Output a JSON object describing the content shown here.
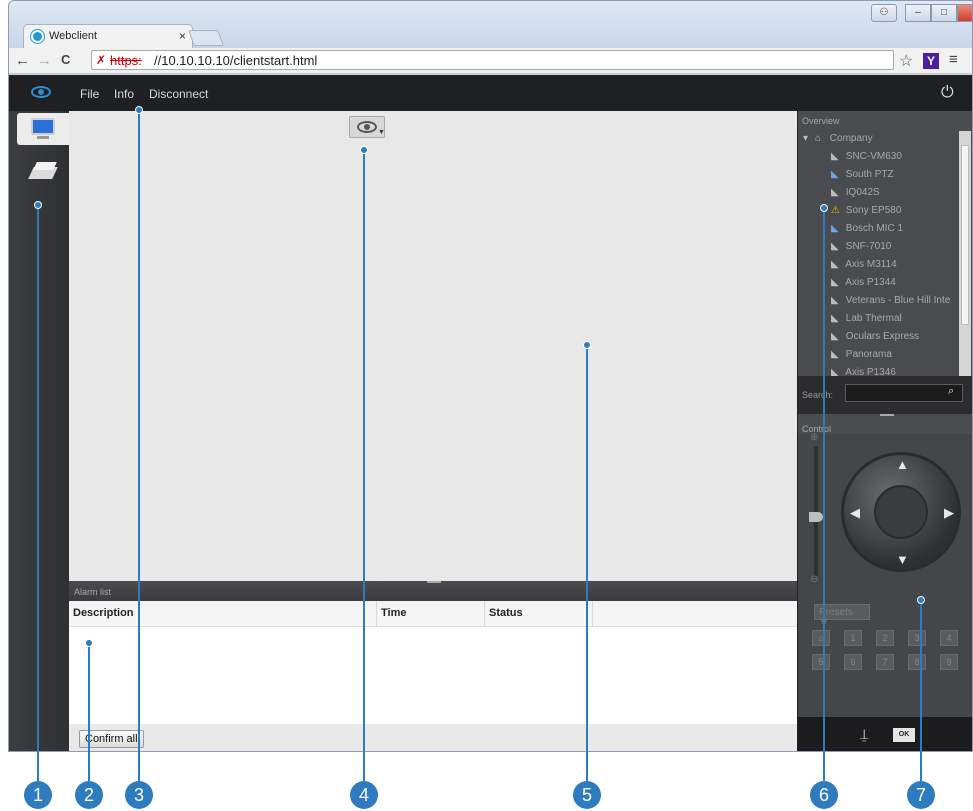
{
  "browser": {
    "tab_title": "Webclient",
    "tab_close": "×",
    "url_scheme": "https:",
    "url_rest": "//10.10.10.10/clientstart.html",
    "nav": {
      "back": "←",
      "forward": "→",
      "reload": "C"
    },
    "star": "☆",
    "ext_label": "Y",
    "menu": "≡",
    "window_buttons": {
      "user": "⚇",
      "minimize": "–",
      "maximize": "□",
      "close": "x"
    }
  },
  "app": {
    "menu": {
      "file": "File",
      "info": "Info",
      "disconnect": "Disconnect"
    },
    "power": "⏻"
  },
  "alarm": {
    "title": "Alarm list",
    "columns": [
      "Description",
      "Time",
      "Status"
    ],
    "confirm_all": "Confirm all"
  },
  "overview": {
    "title": "Overview",
    "root": "Company",
    "cameras": [
      {
        "name": "SNC-VM630",
        "icon": "camera-icon"
      },
      {
        "name": "South PTZ",
        "icon": "ptz-camera-icon"
      },
      {
        "name": "IQ042S",
        "icon": "camera-icon"
      },
      {
        "name": "Sony EP580",
        "icon": "warning-icon"
      },
      {
        "name": "Bosch MIC 1",
        "icon": "ptz-camera-icon"
      },
      {
        "name": "SNF-7010",
        "icon": "camera-icon"
      },
      {
        "name": "Axis M3114",
        "icon": "camera-icon"
      },
      {
        "name": "Axis P1344",
        "icon": "camera-icon"
      },
      {
        "name": "Veterans - Blue Hill Inte",
        "icon": "camera-icon"
      },
      {
        "name": "Lab Thermal",
        "icon": "camera-icon"
      },
      {
        "name": "Oculars Express",
        "icon": "camera-icon"
      },
      {
        "name": "Panorama",
        "icon": "camera-icon"
      },
      {
        "name": "Axis P1346",
        "icon": "camera-icon"
      }
    ],
    "search_label": "Search:"
  },
  "control": {
    "title": "Control",
    "presets_label": "Presets ▼",
    "presets": [
      "⌂",
      "1",
      "2",
      "3",
      "4",
      "5",
      "6",
      "7",
      "8",
      "9"
    ],
    "ok_label": "OK"
  },
  "callouts": [
    "1",
    "2",
    "3",
    "4",
    "5",
    "6",
    "7"
  ],
  "colors": {
    "accent": "#2e7cbf",
    "menu_bg": "#1f2022",
    "panel_bg": "#3a3b3e"
  }
}
